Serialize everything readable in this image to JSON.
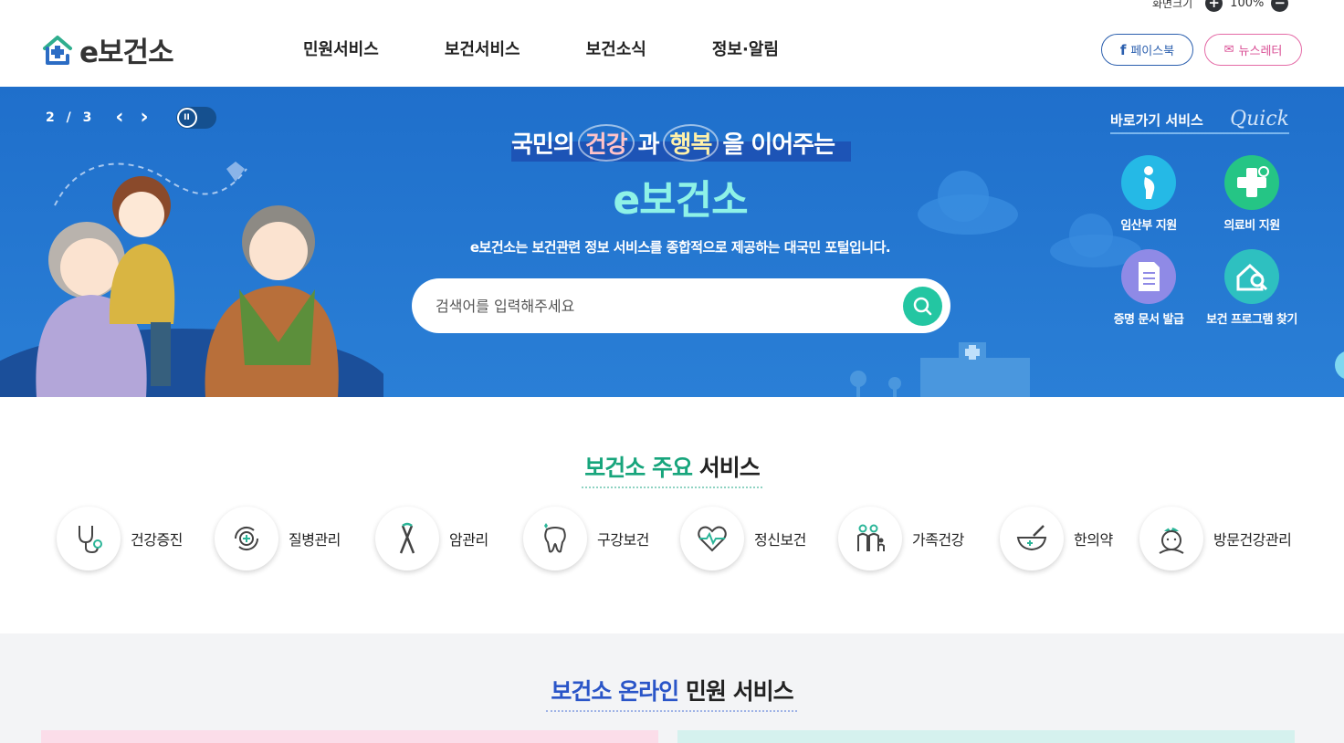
{
  "header": {
    "logo_text": "e보건소",
    "nav": [
      "민원서비스",
      "보건서비스",
      "보건소식",
      "정보·알림"
    ],
    "zoom": {
      "label": "화면크기",
      "value": "100%",
      "plus": "+",
      "minus": "−"
    },
    "facebook_label": "페이스북",
    "newsletter_label": "뉴스레터"
  },
  "hero": {
    "slide_current": "2",
    "slide_sep": "/",
    "slide_total": "3",
    "prev_glyph": "‹",
    "next_glyph": "›",
    "pause_glyph": "II",
    "title_pre": "국민의",
    "keyword1": "건강",
    "title_mid": "과",
    "keyword2": "행복",
    "title_post": "을 이어주는",
    "brand": "e보건소",
    "description": "e보건소는 보건관련 정보 서비스를 종합적으로 제공하는 대국민 포털입니다.",
    "search_placeholder": "검색어를 입력해주세요"
  },
  "quick": {
    "title": "바로가기 서비스",
    "title_en": "Quick",
    "items": [
      {
        "label": "임산부 지원",
        "icon": "pregnant-woman-icon",
        "color": "#25b9e6"
      },
      {
        "label": "의료비 지원",
        "icon": "medical-cross-icon",
        "color": "#25c585"
      },
      {
        "label": "증명 문서 발급",
        "icon": "document-icon",
        "color": "#8f8ae6"
      },
      {
        "label": "보건 프로그램 찾기",
        "icon": "house-search-icon",
        "color": "#2ec0c0"
      }
    ]
  },
  "services": {
    "title_highlight": "보건소 주요",
    "title_rest": "서비스",
    "items": [
      {
        "label": "건강증진",
        "icon": "stethoscope-icon"
      },
      {
        "label": "질병관리",
        "icon": "disease-care-icon"
      },
      {
        "label": "암관리",
        "icon": "cancer-ribbon-icon"
      },
      {
        "label": "구강보건",
        "icon": "tooth-icon"
      },
      {
        "label": "정신보건",
        "icon": "heart-pulse-icon"
      },
      {
        "label": "가족건강",
        "icon": "family-icon"
      },
      {
        "label": "한의약",
        "icon": "herbal-bowl-icon"
      },
      {
        "label": "방문건강관리",
        "icon": "visiting-nurse-icon"
      }
    ]
  },
  "online": {
    "title_highlight": "보건소 온라인",
    "title_rest": "민원 서비스"
  },
  "colors": {
    "hero_bg": "#1f6fcb",
    "accent_green": "#17a57c",
    "accent_blue": "#2a55c8",
    "brand_mint": "#8ef2e7"
  }
}
